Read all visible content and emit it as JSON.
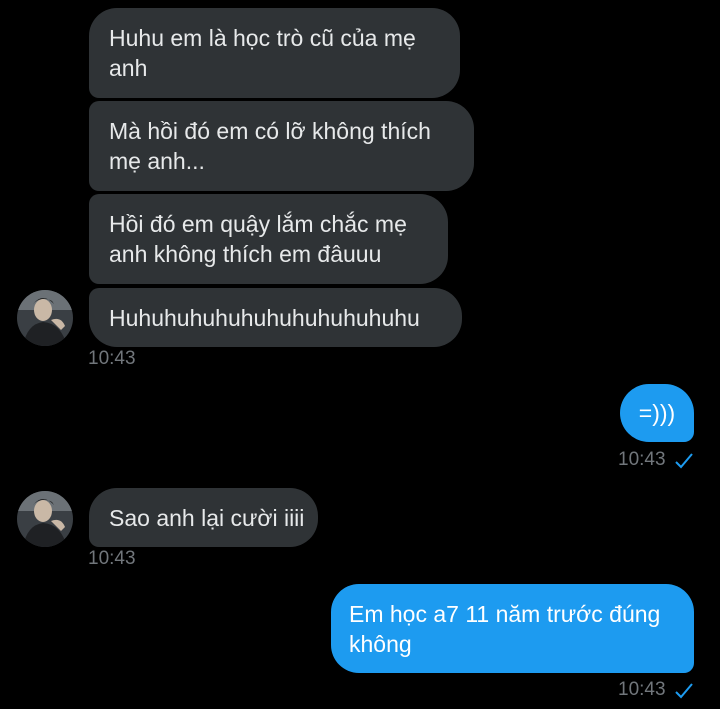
{
  "conversation": {
    "messages": [
      {
        "direction": "incoming",
        "lines": [
          "Huhu em là học trò cũ của mẹ",
          "anh"
        ]
      },
      {
        "direction": "incoming",
        "lines": [
          "Mà hồi đó em có lỡ không thích",
          "mẹ anh..."
        ]
      },
      {
        "direction": "incoming",
        "lines": [
          "Hồi đó em quậy lắm chắc mẹ",
          "anh không thích em đâuuu"
        ]
      },
      {
        "direction": "incoming",
        "lines": [
          "Huhuhuhuhuhuhuhuhuhuhuhu"
        ],
        "time": "10:43"
      },
      {
        "direction": "outgoing",
        "lines": [
          "=)))"
        ],
        "time": "10:43",
        "status": "read-check-icon"
      },
      {
        "direction": "incoming",
        "lines": [
          "Sao anh lại cười iiii"
        ],
        "time": "10:43"
      },
      {
        "direction": "outgoing",
        "lines": [
          "Em học a7 11 năm trước đúng",
          "không"
        ],
        "time": "10:43",
        "status": "read-check-icon"
      }
    ]
  },
  "colors": {
    "background": "#000000",
    "incoming_bubble": "#2f3336",
    "outgoing_bubble": "#1d9bf0",
    "timestamp": "#71767b",
    "check": "#1d9bf0"
  }
}
